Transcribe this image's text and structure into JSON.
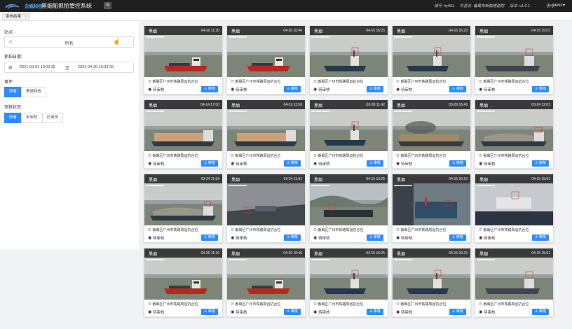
{
  "header": {
    "brand": "云帆科技",
    "title": "黑烟船抓拍管控系统",
    "menu_icon": "menu-icon",
    "info": [
      {
        "label": "编号:",
        "value": "hy001"
      },
      {
        "label": "机器名:",
        "value": "番禺东新航道监控"
      },
      {
        "label": "版本:",
        "value": "v1.0.1"
      }
    ],
    "user": "yj-guest ▾"
  },
  "breadcrumb": {
    "tab": "审核结果",
    "close": "×"
  },
  "filters": {
    "site_label": "站点:",
    "site_value": "所有",
    "date_label": "抓拍日期:",
    "date_start": "2021-03-01 10:03:25",
    "date_sep": "至",
    "date_end": "2021-04-30 10:03:25",
    "event_label": "事件:",
    "events": [
      "所有",
      "黑烟排放"
    ],
    "review_label": "审核状态:",
    "reviews": [
      "所有",
      "未审核",
      "已审核"
    ]
  },
  "cards": [
    {
      "tag": "黑烟",
      "time": "04-20 11:20",
      "loc": "番禺区广州市铁路局运抗合位",
      "status": "待审核",
      "btn": "审核"
    },
    {
      "tag": "黑烟",
      "time": "04-20 10:46",
      "loc": "番禺区广州市铁路局运抗合位",
      "status": "待审核",
      "btn": "审核"
    },
    {
      "tag": "黑烟",
      "time": "04-15 16:25",
      "loc": "番禺区广州市铁路局运抗合位",
      "status": "待审核",
      "btn": "审核"
    },
    {
      "tag": "黑烟",
      "time": "04-15 16:23",
      "loc": "番禺区广州市铁路局运抗合位",
      "status": "待审核",
      "btn": "审核"
    },
    {
      "tag": "黑烟",
      "time": "04-15 15:01",
      "loc": "番禺区广州市铁路局运抗合位",
      "status": "待审核",
      "btn": "审核"
    },
    {
      "tag": "黑烟",
      "time": "04-14 17:00",
      "loc": "番禺区广州市铁路局运抗合位",
      "status": "待审核",
      "btn": "审核"
    },
    {
      "tag": "黑烟",
      "time": "04-10 11:56",
      "loc": "番禺区广州市铁路局运抗合位",
      "status": "待审核",
      "btn": "审核"
    },
    {
      "tag": "黑烟",
      "time": "03-30 11:42",
      "loc": "番禺区广州市铁路局运抗合位",
      "status": "待审核",
      "btn": "审核"
    },
    {
      "tag": "黑烟",
      "time": "03-29 16:46",
      "loc": "番禺区广州市铁路局运抗合位",
      "status": "待审核",
      "btn": "审核"
    },
    {
      "tag": "黑烟",
      "time": "03-24 12:01",
      "loc": "番禺区广州市铁路局运抗合位",
      "status": "待审核",
      "btn": "审核"
    },
    {
      "tag": "黑烟",
      "time": "03-24 11:59",
      "loc": "番禺区广州市铁路局运抗合位",
      "status": "待审核",
      "btn": "审核"
    },
    {
      "tag": "黑烟",
      "time": "03-24 11:01",
      "loc": "番禺区广州市铁路局运抗合位",
      "status": "待审核",
      "btn": "审核"
    },
    {
      "tag": "黑烟",
      "time": "04-15 16:25",
      "loc": "番禺区广州市铁路局运抗合位",
      "status": "待审核",
      "btn": "审核"
    },
    {
      "tag": "黑烟",
      "time": "04-15 16:23",
      "loc": "番禺区广州市铁路局运抗合位",
      "status": "待审核",
      "btn": "审核"
    },
    {
      "tag": "黑烟",
      "time": "04-15 15:01",
      "loc": "番禺区广州市铁路局运抗合位",
      "status": "待审核",
      "btn": "审核"
    },
    {
      "tag": "黑烟",
      "time": "04-20 11:20",
      "loc": "番禺区广州市铁路局运抗合位",
      "status": "待审核",
      "btn": "审核"
    },
    {
      "tag": "黑烟",
      "time": "04-20 10:46",
      "loc": "番禺区广州市铁路局运抗合位",
      "status": "待审核",
      "btn": "审核"
    },
    {
      "tag": "黑烟",
      "time": "04-15 16:25",
      "loc": "番禺区广州市铁路局运抗合位",
      "status": "待审核",
      "btn": "审核"
    },
    {
      "tag": "黑烟",
      "time": "04-15 16:23",
      "loc": "番禺区广州市铁路局运抗合位",
      "status": "待审核",
      "btn": "审核"
    },
    {
      "tag": "黑烟",
      "time": "04-15 15:01",
      "loc": "番禺区广州市铁路局运抗合位",
      "status": "待审核",
      "btn": "审核"
    }
  ],
  "colors": {
    "accent": "#2f8cff",
    "topbar": "#1f1f1f",
    "card_header": "#3a3a3a"
  }
}
